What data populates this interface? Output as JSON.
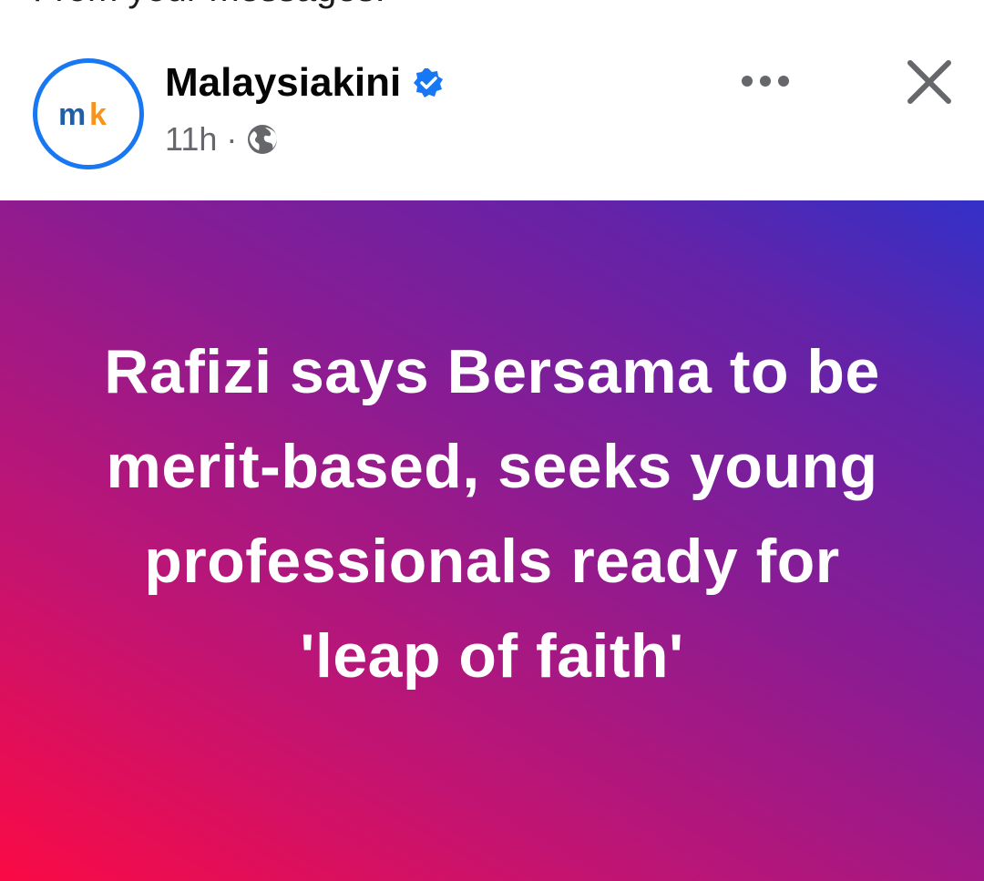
{
  "previous_text": "From your messages.",
  "post": {
    "page_name": "Malaysiakini",
    "verified": true,
    "timestamp": "11h",
    "separator": "·",
    "audience_icon": "globe-icon",
    "avatar": {
      "logo_text": "mk",
      "ring_color": "#1877f2",
      "letter_m_color": "#1f5fa8",
      "letter_k_color": "#f7941d"
    }
  },
  "actions": {
    "more_icon": "more-horizontal-icon",
    "close_icon": "close-icon"
  },
  "banner": {
    "headline": "Rafizi says Bersama to be merit-based, seeks young professionals ready for 'leap of faith'",
    "colors": [
      "#fa0a45",
      "#c21472",
      "#8a1c93",
      "#6323a8",
      "#3330c8"
    ]
  }
}
